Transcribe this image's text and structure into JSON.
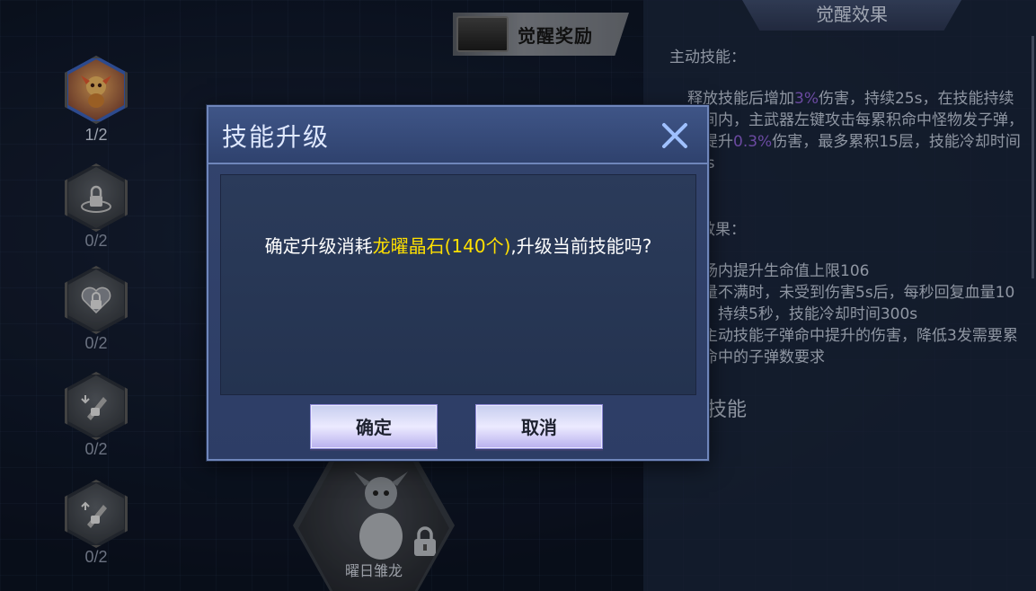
{
  "left_nodes": [
    {
      "icon": "fire-dragon-skill-icon",
      "count": "1/2",
      "state": "active"
    },
    {
      "icon": "locked-shield-skill-icon",
      "count": "0/2",
      "state": "locked"
    },
    {
      "icon": "locked-heart-skill-icon",
      "count": "0/2",
      "state": "locked"
    },
    {
      "icon": "locked-bullet-down-skill-icon",
      "count": "0/2",
      "state": "locked"
    },
    {
      "icon": "locked-bullet-up-skill-icon",
      "count": "0/2",
      "state": "locked"
    }
  ],
  "reward_banner": {
    "label": "觉醒奖励",
    "icon": "treasure-chest-icon"
  },
  "dragon": {
    "name": "曜日雏龙",
    "icon": "dragon-egg-icon",
    "state": "locked"
  },
  "right_panel": {
    "title": "觉醒效果",
    "active_label": "主动技能：",
    "active_desc_1": "释放技能后增加",
    "active_pct_1": "3%",
    "active_desc_2": "伤害，持续25s，在技能持续时间内，主武器左键攻击每累积命中怪物",
    "active_desc_3": "发子弹，可提升",
    "active_pct_2": "0.3%",
    "active_desc_4": "伤害，最多累积15层，技能冷却时间90s",
    "passive_label": "被动效果：",
    "passive_line_1": "…场内提升生命值上限106",
    "passive_line_2": "血量不满时，未受到伤害5s后，每秒回复血量10点，持续5秒，技能冷却时间300s",
    "passive_line_3": "…主动技能子弹命中提升的伤害，降低3发需要累积命中的子弹数要求",
    "section_label": "镶嵌技能"
  },
  "modal": {
    "title": "技能升级",
    "message_prefix": "确定升级消耗",
    "message_highlight": "龙曜晶石(140个)",
    "message_suffix": ",升级当前技能吗?",
    "confirm_label": "确定",
    "cancel_label": "取消",
    "highlight_color": "#ffe000"
  }
}
